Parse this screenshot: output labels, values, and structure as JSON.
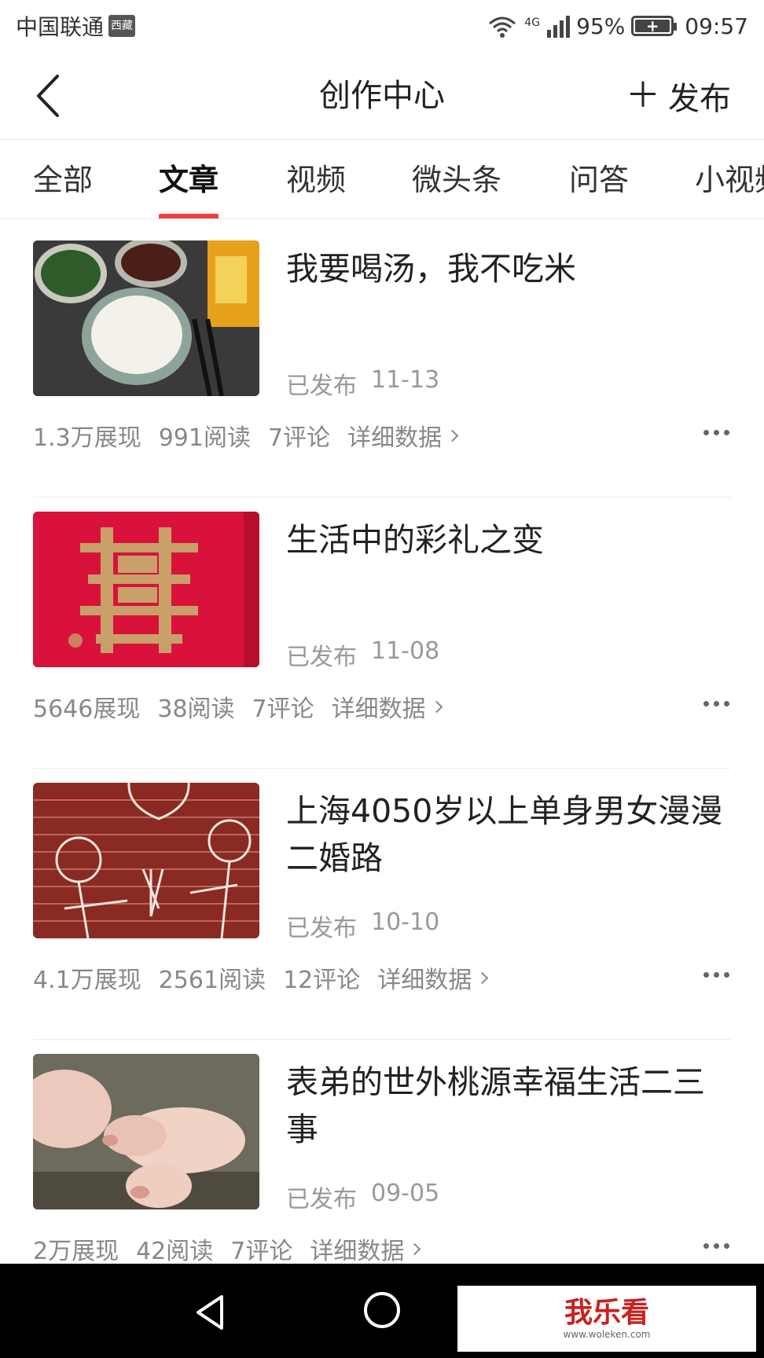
{
  "status_bar": {
    "carrier": "中国联通",
    "carrier_badge": "西藏",
    "network": "4G",
    "battery": "95%",
    "time": "09:57"
  },
  "nav": {
    "title": "创作中心",
    "publish_label": "发布"
  },
  "tabs": [
    {
      "label": "全部",
      "active": false
    },
    {
      "label": "文章",
      "active": true
    },
    {
      "label": "视频",
      "active": false
    },
    {
      "label": "微头条",
      "active": false
    },
    {
      "label": "问答",
      "active": false
    },
    {
      "label": "小视频",
      "active": false
    }
  ],
  "articles": [
    {
      "title": "我要喝汤，我不吃米",
      "status": "已发布",
      "date": "11-13",
      "impressions": "1.3万展现",
      "reads": "991阅读",
      "comments": "7评论",
      "detail_label": "详细数据",
      "thumbnail": "meal-photo"
    },
    {
      "title": "生活中的彩礼之变",
      "status": "已发布",
      "date": "11-08",
      "impressions": "5646展现",
      "reads": "38阅读",
      "comments": "7评论",
      "detail_label": "详细数据",
      "thumbnail": "double-happiness-photo"
    },
    {
      "title": "上海4050岁以上单身男女漫漫二婚路",
      "status": "已发布",
      "date": "10-10",
      "impressions": "4.1万展现",
      "reads": "2561阅读",
      "comments": "12评论",
      "detail_label": "详细数据",
      "thumbnail": "brick-wall-couple-drawing"
    },
    {
      "title": "表弟的世外桃源幸福生活二三事",
      "status": "已发布",
      "date": "09-05",
      "impressions": "2万展现",
      "reads": "42阅读",
      "comments": "7评论",
      "detail_label": "详细数据",
      "thumbnail": "pigs-photo"
    }
  ],
  "watermark": {
    "main": "我乐看",
    "sub": "www.woleken.com"
  },
  "colors": {
    "accent": "#f04142",
    "muted_text": "#999999"
  }
}
